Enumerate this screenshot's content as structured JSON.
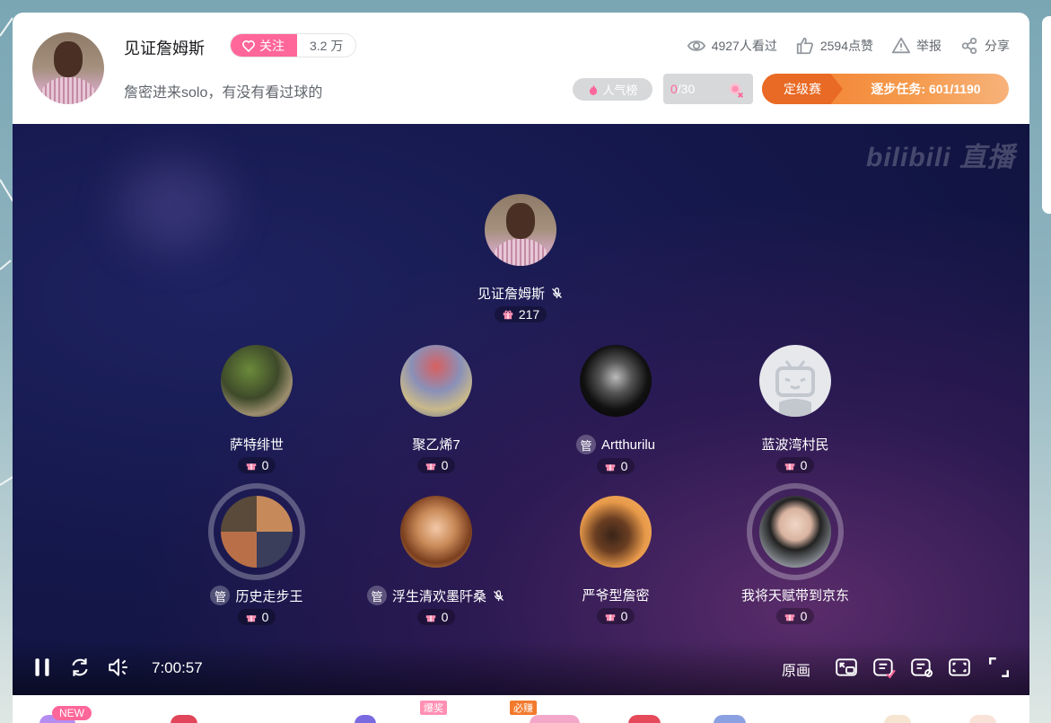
{
  "header": {
    "anchor_name": "见证詹姆斯",
    "follow_label": "关注",
    "follower_count": "3.2 万",
    "room_title": "詹密进来solo，有没有看过球的",
    "stats": {
      "viewers": "4927人看过",
      "likes": "2594点赞",
      "report": "举报",
      "share": "分享"
    },
    "rank_label": "人气榜",
    "counter": {
      "current": "0",
      "total": "/30"
    },
    "rank_match": {
      "tag": "定级赛",
      "task": "逐步任务: 601/1190"
    }
  },
  "video": {
    "watermark": "bilibili 直播",
    "host": {
      "name": "见证詹姆斯",
      "gifts": "217",
      "muted": true
    },
    "seats_row1": [
      {
        "name": "萨特绯世",
        "gifts": "0",
        "admin": false,
        "muted": false
      },
      {
        "name": "聚乙烯7",
        "gifts": "0",
        "admin": false,
        "muted": false
      },
      {
        "name": "Artthurilu",
        "gifts": "0",
        "admin": true,
        "muted": false
      },
      {
        "name": "蓝波湾村民",
        "gifts": "0",
        "admin": false,
        "muted": false
      }
    ],
    "seats_row2": [
      {
        "name": "历史走步王",
        "gifts": "0",
        "admin": true,
        "muted": false
      },
      {
        "name": "浮生清欢墨阡桑",
        "gifts": "0",
        "admin": true,
        "muted": true
      },
      {
        "name": "严爷型詹密",
        "gifts": "0",
        "admin": false,
        "muted": false
      },
      {
        "name": "我将天赋带到京东",
        "gifts": "0",
        "admin": false,
        "muted": false
      }
    ],
    "admin_badge": "管",
    "controls": {
      "time": "7:00:57",
      "quality": "原画"
    }
  },
  "bottom": {
    "new_tag": "NEW",
    "promo1": "爆奖",
    "promo2": "必赚"
  },
  "colors": {
    "pink": "#ff6699",
    "orange": "#f27a2c"
  }
}
